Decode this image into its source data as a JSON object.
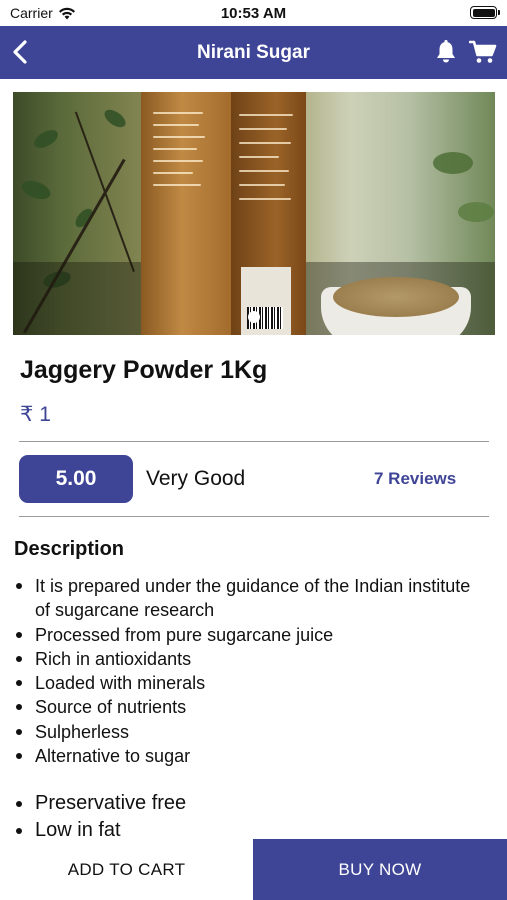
{
  "status_bar": {
    "carrier": "Carrier",
    "time": "10:53 AM",
    "wifi_icon": "wifi-icon",
    "battery_icon": "battery-icon"
  },
  "nav": {
    "title": "Nirani Sugar",
    "back_icon": "chevron-left-icon",
    "bell_icon": "bell-icon",
    "cart_icon": "cart-icon",
    "color": "#3f4596"
  },
  "product": {
    "image_alt": "product-photo",
    "carousel": {
      "current": 1,
      "count": 1
    },
    "title": "Jaggery Powder 1Kg",
    "price": "₹ 1"
  },
  "rating": {
    "score": "5.00",
    "label": "Very Good",
    "reviews": "7 Reviews"
  },
  "description": {
    "heading": "Description",
    "items": [
      "It is prepared under the guidance of the Indian institute of sugarcane research",
      "Processed from pure sugarcane juice",
      "Rich in antioxidants",
      "Loaded with minerals",
      "Source of nutrients",
      "Sulpherless",
      "Alternative to sugar"
    ],
    "items_extra": [
      "Preservative free",
      "Low in fat"
    ]
  },
  "actions": {
    "add_to_cart": "ADD TO CART",
    "buy_now": "BUY NOW"
  }
}
